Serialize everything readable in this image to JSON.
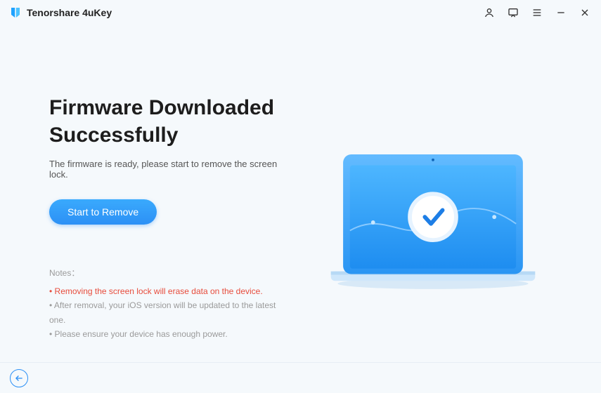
{
  "app": {
    "name": "Tenorshare 4uKey"
  },
  "titlebar": {
    "icons": {
      "account": "account-icon",
      "feedback": "feedback-icon",
      "menu": "menu-icon",
      "minimize": "minimize-icon",
      "close": "close-icon"
    }
  },
  "main": {
    "title": "Firmware Downloaded Successfully",
    "subtitle": "The firmware is ready, please start to remove the screen lock.",
    "cta_label": "Start to Remove"
  },
  "notes": {
    "label": "Notes：",
    "items": [
      {
        "text": "• Removing the screen lock will erase data on the device.",
        "warning": true
      },
      {
        "text": "• After removal, your iOS version will be updated to the latest one.",
        "warning": false
      },
      {
        "text": "• Please ensure your device has enough power.",
        "warning": false
      }
    ]
  },
  "footer": {
    "back": "back"
  },
  "colors": {
    "accent": "#2c90f5",
    "warning": "#e74c3c"
  }
}
